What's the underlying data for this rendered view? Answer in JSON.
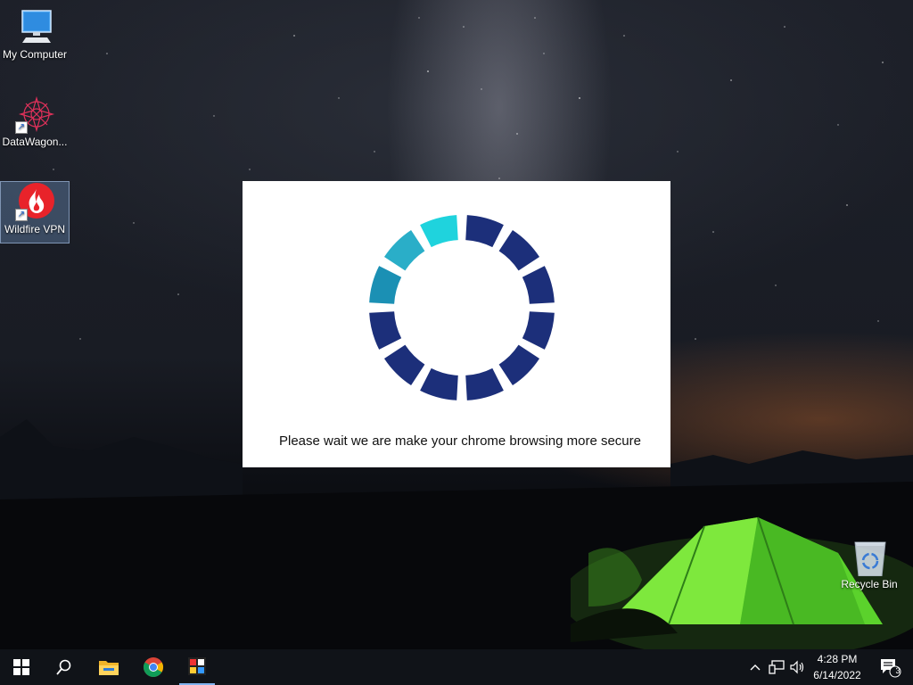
{
  "desktop": {
    "icons": [
      {
        "label": "My Computer",
        "icon": "computer-icon"
      },
      {
        "label": "DataWagon...",
        "icon": "datawagon-icon"
      },
      {
        "label": "Wildfire VPN",
        "icon": "wildfire-vpn-icon"
      },
      {
        "label": "Recycle Bin",
        "icon": "recycle-bin-icon"
      }
    ]
  },
  "dialog": {
    "message": "Please wait we are make your chrome browsing more secure",
    "spinner": {
      "segments": 12,
      "highlighted_segments": 3,
      "colors": {
        "dark": "#1c2f7a",
        "light": "#1fd3dd",
        "mid": "#2aaec8",
        "dim": "#1b90b4"
      }
    }
  },
  "taskbar": {
    "buttons": [
      "start-icon",
      "search-icon",
      "file-explorer-icon",
      "chrome-icon",
      "app-icon"
    ],
    "tray": {
      "time": "4:28 PM",
      "date": "6/14/2022",
      "notifications_count": "3"
    }
  }
}
